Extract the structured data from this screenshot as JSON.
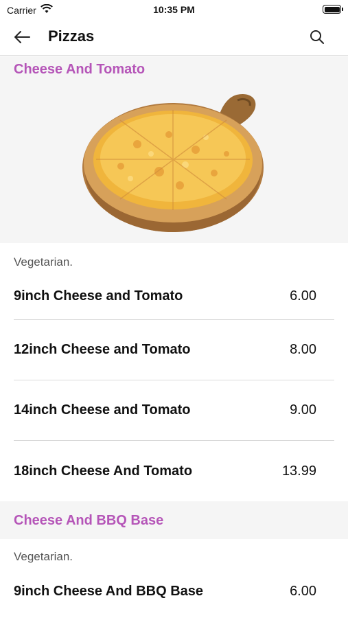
{
  "status": {
    "carrier": "Carrier",
    "time": "10:35 PM"
  },
  "nav": {
    "title": "Pizzas"
  },
  "categories": [
    {
      "name": "Cheese And Tomato",
      "description": "Vegetarian.",
      "items": [
        {
          "name": "9inch Cheese and Tomato",
          "price": "6.00"
        },
        {
          "name": "12inch Cheese and Tomato",
          "price": "8.00"
        },
        {
          "name": "14inch Cheese and Tomato",
          "price": "9.00"
        },
        {
          "name": "18inch Cheese And Tomato",
          "price": "13.99"
        }
      ]
    },
    {
      "name": "Cheese And BBQ Base",
      "description": "Vegetarian.",
      "items": [
        {
          "name": "9inch Cheese And BBQ Base",
          "price": "6.00"
        }
      ]
    }
  ],
  "colors": {
    "accent": "#b555b8",
    "divider": "#d9d9d9",
    "section_bg": "#f5f5f5"
  },
  "icons": {
    "back": "arrow-left-icon",
    "search": "search-icon",
    "wifi": "wifi-icon",
    "battery": "battery-icon"
  }
}
